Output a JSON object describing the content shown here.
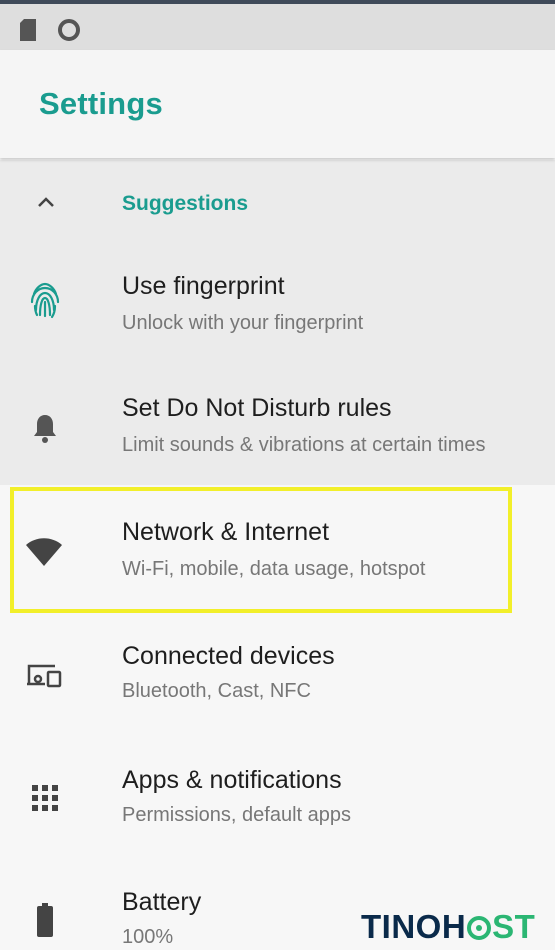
{
  "app_title": "Settings",
  "suggestions": {
    "header": "Suggestions",
    "items": [
      {
        "icon": "fingerprint-icon",
        "title": "Use fingerprint",
        "subtitle": "Unlock with your fingerprint"
      },
      {
        "icon": "bell-icon",
        "title": "Set Do Not Disturb rules",
        "subtitle": "Limit sounds & vibrations at certain times"
      }
    ]
  },
  "settings_items": [
    {
      "icon": "wifi-icon",
      "title": "Network & Internet",
      "subtitle": "Wi-Fi, mobile, data usage, hotspot"
    },
    {
      "icon": "devices-icon",
      "title": "Connected devices",
      "subtitle": "Bluetooth, Cast, NFC"
    },
    {
      "icon": "apps-grid-icon",
      "title": "Apps & notifications",
      "subtitle": "Permissions, default apps"
    },
    {
      "icon": "battery-icon",
      "title": "Battery",
      "subtitle": "100%"
    }
  ],
  "watermark": {
    "part1": "TINOH",
    "part2": "ST"
  },
  "colors": {
    "accent": "#1a9c8f",
    "highlight": "#f2ef2a",
    "suggest_bg": "#ebebeb"
  }
}
